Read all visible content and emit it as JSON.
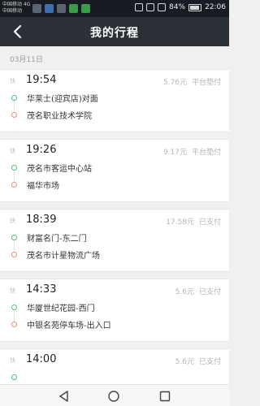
{
  "status_bar": {
    "carrier_line1": "中国移动 4G",
    "carrier_line2": "中国移动",
    "battery": "84%",
    "time": "22:06"
  },
  "header": {
    "title": "我的行程"
  },
  "date_group": "03月11日",
  "trips": [
    {
      "tag": "快",
      "time": "19:54",
      "price": "5.76元",
      "status": "平台垫付",
      "from": "华莱士(迎宾店)对面",
      "to": "茂名职业技术学院"
    },
    {
      "tag": "快",
      "time": "19:26",
      "price": "9.17元",
      "status": "平台垫付",
      "from": "茂名市客运中心站",
      "to": "福华市场"
    },
    {
      "tag": "快",
      "time": "18:39",
      "price": "17.58元",
      "status": "已支付",
      "from": "财富名门-东二门",
      "to": "茂名市计星物流广场"
    },
    {
      "tag": "快",
      "time": "14:33",
      "price": "5.6元",
      "status": "已支付",
      "from": "华厦世纪花园-西门",
      "to": "中银名苑停车场-出入口"
    },
    {
      "tag": "快",
      "time": "14:00",
      "price": "5.6元",
      "status": "已支付",
      "from": "",
      "to": ""
    }
  ],
  "colors": {
    "titlebar": "#2b2f36",
    "start_dot": "#4bbf72",
    "end_dot": "#f08c78"
  }
}
